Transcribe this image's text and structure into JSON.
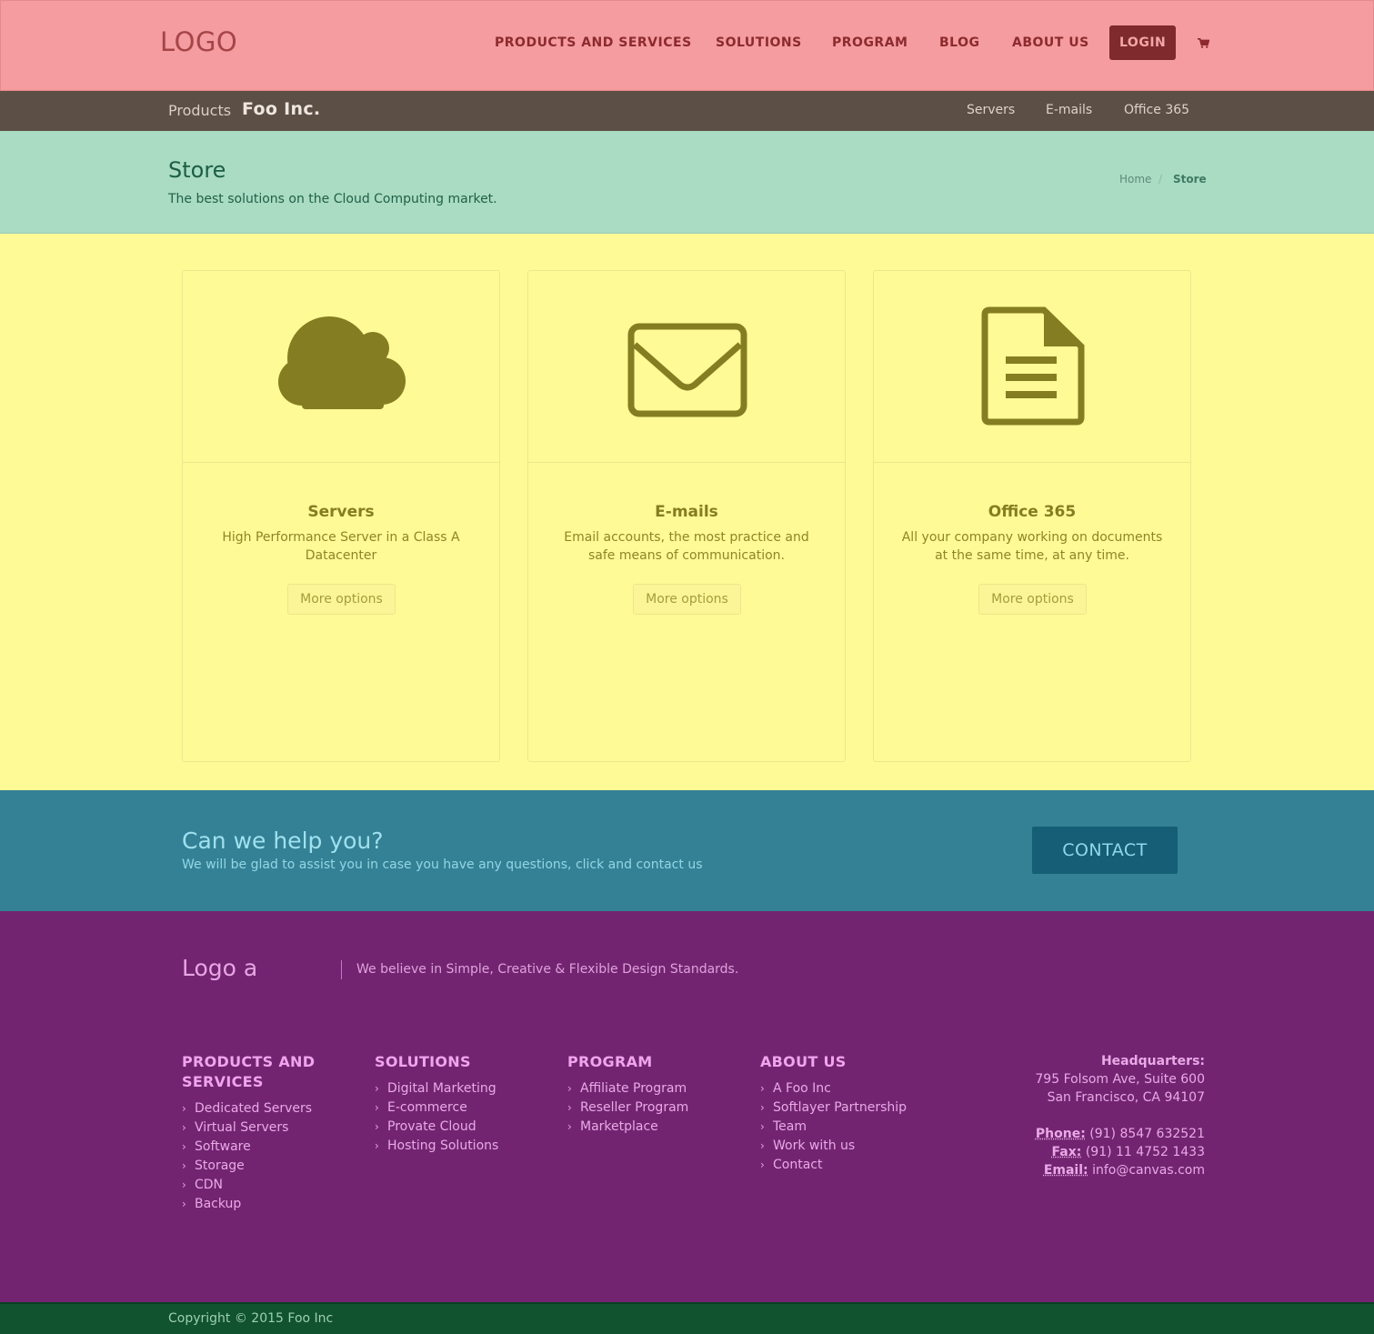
{
  "header": {
    "logo": "LOGO",
    "nav": [
      {
        "label": "PRODUCTS AND SERVICES"
      },
      {
        "label": "SOLUTIONS"
      },
      {
        "label": "PROGRAM"
      },
      {
        "label": "BLOG"
      },
      {
        "label": "ABOUT US"
      }
    ],
    "login_label": "LOGIN",
    "cart_icon": "shopping-cart-icon"
  },
  "subbar": {
    "prefix": "Products",
    "brand": "Foo Inc.",
    "links": [
      "Servers",
      "E-mails",
      "Office 365"
    ]
  },
  "page": {
    "title": "Store",
    "subtitle": "The best solutions on the Cloud Computing market.",
    "breadcrumb": {
      "home": "Home",
      "separator": "/",
      "current": "Store"
    }
  },
  "cards": [
    {
      "icon": "cloud-icon",
      "title": "Servers",
      "text": "High Performance Server in a Class A Datacenter",
      "button": "More options"
    },
    {
      "icon": "envelope-icon",
      "title": "E-mails",
      "text": "Email accounts, the most practice and safe means of communication.",
      "button": "More options"
    },
    {
      "icon": "document-icon",
      "title": "Office 365",
      "text": "All your company working on documents at the same time, at any time.",
      "button": "More options"
    }
  ],
  "help": {
    "title": "Can we help you?",
    "text": "We will be glad to assist you in case you have any questions, click and contact us",
    "button": "CONTACT"
  },
  "footer": {
    "logo": "Logo a",
    "tagline": "We believe in Simple, Creative & Flexible Design Standards.",
    "columns": [
      {
        "heading": "PRODUCTS AND SERVICES",
        "items": [
          "Dedicated Servers",
          "Virtual Servers",
          "Software",
          "Storage",
          "CDN",
          "Backup"
        ]
      },
      {
        "heading": "SOLUTIONS",
        "items": [
          "Digital Marketing",
          "E-commerce",
          "Provate Cloud",
          "Hosting Solutions"
        ]
      },
      {
        "heading": "PROGRAM",
        "items": [
          "Affiliate Program",
          "Reseller Program",
          "Marketplace"
        ]
      },
      {
        "heading": "ABOUT US",
        "items": [
          "A Foo Inc",
          "Softlayer Partnership",
          "Team",
          "Work with us",
          "Contact"
        ]
      }
    ],
    "contact": {
      "hq_label": "Headquarters:",
      "address_line1": "795 Folsom Ave, Suite 600",
      "address_line2": "San Francisco, CA 94107",
      "phone_label": "Phone:",
      "phone": "(91) 8547 632521",
      "fax_label": "Fax:",
      "fax": "(91) 11 4752 1433",
      "email_label": "Email:",
      "email": "info@canvas.com"
    }
  },
  "copyright": "Copyright © 2015 Foo Inc",
  "colors": {
    "header_bg": "#f49c9f",
    "subbar_bg": "#5c4f46",
    "titlebar_bg": "#aadbc3",
    "content_bg": "#fefa96",
    "icon_color": "#857d21",
    "help_bg": "#348195",
    "footer_bg": "#722471",
    "copyright_bg": "#11522f"
  }
}
